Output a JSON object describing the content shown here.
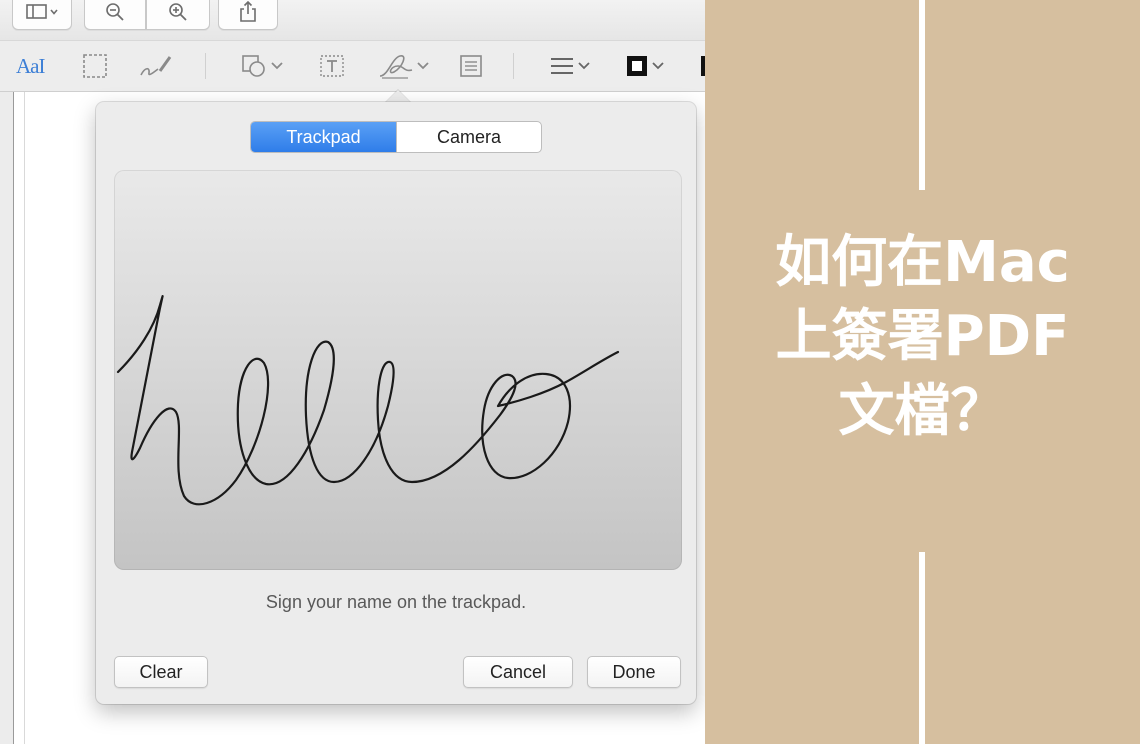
{
  "toolbar": {
    "icons": [
      "sidebar-icon",
      "zoom-out-icon",
      "zoom-in-icon",
      "share-icon"
    ]
  },
  "markup_toolbar": {
    "text_style_label": "AaI",
    "tools": [
      "selection-icon",
      "sketch-icon",
      "shapes-icon",
      "text-box-icon",
      "sign-icon",
      "note-icon",
      "shape-style-icon",
      "border-color-icon"
    ]
  },
  "signature_popover": {
    "tabs": [
      {
        "label": "Trackpad",
        "selected": true
      },
      {
        "label": "Camera",
        "selected": false
      }
    ],
    "signature_text": "hello",
    "hint": "Sign your name on the trackpad.",
    "buttons": {
      "clear": "Clear",
      "cancel": "Cancel",
      "done": "Done"
    }
  },
  "banner": {
    "title_lines": [
      "如何在Mac",
      "上簽署PDF",
      "文檔？"
    ],
    "background_color": "#d6bf9f",
    "text_color": "#ffffff"
  },
  "colors": {
    "accent": "#2f7de9",
    "window_bg": "#ececec"
  }
}
